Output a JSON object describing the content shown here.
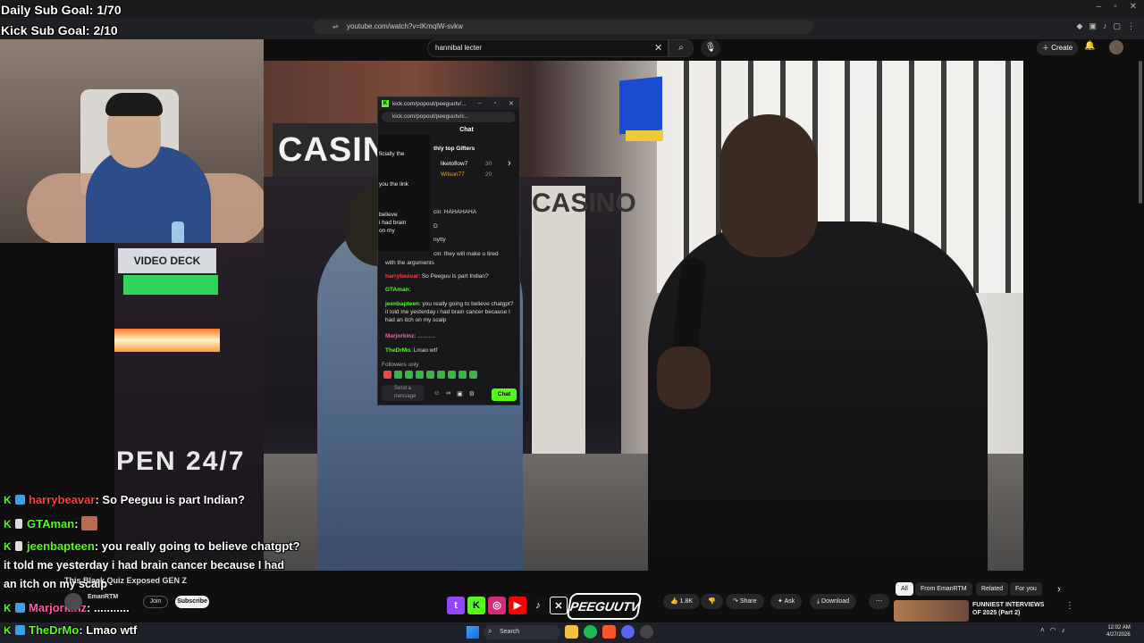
{
  "overlay": {
    "daily_goal": "Daily Sub Goal: 1/70",
    "kick_goal": "Kick Sub Goal: 2/10"
  },
  "browser": {
    "url": "youtube.com/watch?v=lKmqlW-svkw"
  },
  "youtube": {
    "search_value": "hannibal lecter",
    "create_label": "Create",
    "video_title": "This Black Quiz Exposed GEN Z",
    "channel_name": "EmanRTM",
    "join_label": "Join",
    "subscribe_label": "Subscribe",
    "likes": "1.8K",
    "share_label": "Share",
    "ask_label": "Ask",
    "download_label": "Download",
    "chips": [
      "All",
      "From EmanRTM",
      "Related",
      "For you"
    ],
    "suggestion_title": "FUNNIEST INTERVIEWS OF 2025 (Part 2)"
  },
  "video_scene": {
    "casino_sign": "CASIN",
    "casino_vertical": "CASINO",
    "neon_sign": "VIDEO DECK",
    "open_text": "PEN 24/7"
  },
  "kick_popout": {
    "title": "kick.com/popout/peeguutv/...",
    "url": "kick.com/popout/peeguutv/c...",
    "chat_header": "Chat",
    "side_lines": [
      "ficially the",
      "you the link",
      "believe",
      "i had brain",
      "on my"
    ],
    "gifters_label": "thly top Gifters",
    "gifters": [
      {
        "name": "liketoflow7",
        "value": "30"
      },
      {
        "name": "Wilson77",
        "value": "20"
      }
    ],
    "lines": [
      {
        "user": "",
        "text": "cin: HAHAHAHA"
      },
      {
        "user": "",
        "text": "D"
      },
      {
        "user": "",
        "text": "nytty"
      },
      {
        "user": "",
        "text": "cin: they will make u tired"
      },
      {
        "user": "",
        "text": "with the arguments"
      },
      {
        "user": "harrybeavar",
        "text": ": So Peeguu is part Indian?"
      },
      {
        "user": "GTAman",
        "text": ":"
      },
      {
        "user": "jeenbapteen",
        "text": ": you really going to believe chatgpt? it told me yesterday i had brain cancer because I had an itch on my scalp"
      },
      {
        "user": "Marjorkinz",
        "text": ": ..........."
      },
      {
        "user": "TheDrMo",
        "text": ": Lmao wtf"
      }
    ],
    "followers_only": "Followers only",
    "input_placeholder": "Send a message",
    "send_label": "Chat"
  },
  "stream_chat": [
    {
      "user": "harrybeavar",
      "text": ": So Peeguu is part Indian?"
    },
    {
      "user": "GTAman",
      "text": ":"
    },
    {
      "user": "jeenbapteen",
      "text": ": you really going to believe chatgpt?"
    },
    {
      "user": "",
      "text": "it told me yesterday i had brain cancer because I had"
    },
    {
      "user": "",
      "text": "an itch on my scalp"
    },
    {
      "user": "Marjorkinz",
      "text": ": ..........."
    },
    {
      "user": "TheDrMo",
      "text": ": Lmao wtf"
    }
  ],
  "branding": {
    "logo": "PEEGUUTV"
  },
  "taskbar": {
    "search_label": "Search",
    "time": "12:02 AM",
    "date": "4/27/2026"
  }
}
